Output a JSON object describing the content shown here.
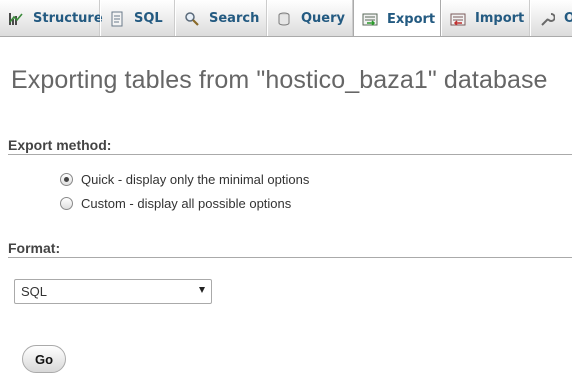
{
  "tabs": [
    {
      "label": "Structure",
      "icon": "structure-icon",
      "active": false
    },
    {
      "label": "SQL",
      "icon": "sql-icon",
      "active": false
    },
    {
      "label": "Search",
      "icon": "search-icon",
      "active": false
    },
    {
      "label": "Query",
      "icon": "query-icon",
      "active": false
    },
    {
      "label": "Export",
      "icon": "export-icon",
      "active": true
    },
    {
      "label": "Import",
      "icon": "import-icon",
      "active": false
    },
    {
      "label": "O",
      "icon": "operations-icon",
      "active": false
    }
  ],
  "page_title": "Exporting tables from \"hostico_baza1\" database",
  "export_method": {
    "heading": "Export method:",
    "options": [
      {
        "label": "Quick - display only the minimal options",
        "checked": true
      },
      {
        "label": "Custom - display all possible options",
        "checked": false
      }
    ]
  },
  "format": {
    "heading": "Format:",
    "selected": "SQL"
  },
  "go_label": "Go",
  "colors": {
    "tab_text": "#235a81",
    "title": "#666666"
  }
}
